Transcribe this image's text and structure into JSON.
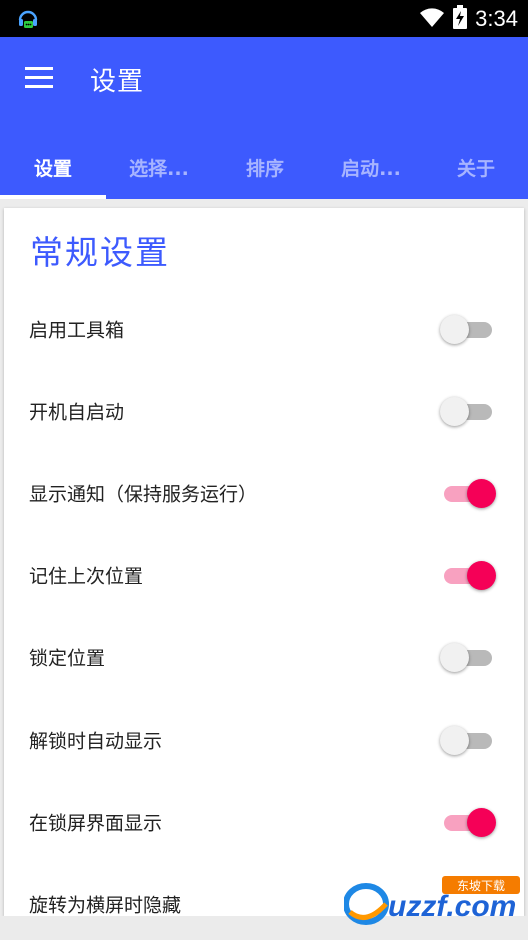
{
  "status_bar": {
    "time": "3:34"
  },
  "toolbar": {
    "title": "设置"
  },
  "tabs": [
    {
      "label": "设置",
      "active": true
    },
    {
      "label": "选择...",
      "active": false
    },
    {
      "label": "排序",
      "active": false
    },
    {
      "label": "启动...",
      "active": false
    },
    {
      "label": "关于",
      "active": false
    }
  ],
  "section": {
    "title": "常规设置"
  },
  "settings": [
    {
      "label": "启用工具箱",
      "on": false
    },
    {
      "label": "开机自启动",
      "on": false
    },
    {
      "label": "显示通知（保持服务运行）",
      "on": true
    },
    {
      "label": "记住上次位置",
      "on": true
    },
    {
      "label": "锁定位置",
      "on": false
    },
    {
      "label": "解锁时自动显示",
      "on": false
    },
    {
      "label": "在锁屏界面显示",
      "on": true
    },
    {
      "label": "旋转为横屏时隐藏",
      "on": null
    }
  ],
  "watermark": {
    "text": "uzzf.com",
    "subtext": "东坡下载"
  },
  "colors": {
    "primary": "#3d5afe",
    "accent": "#f50057"
  }
}
